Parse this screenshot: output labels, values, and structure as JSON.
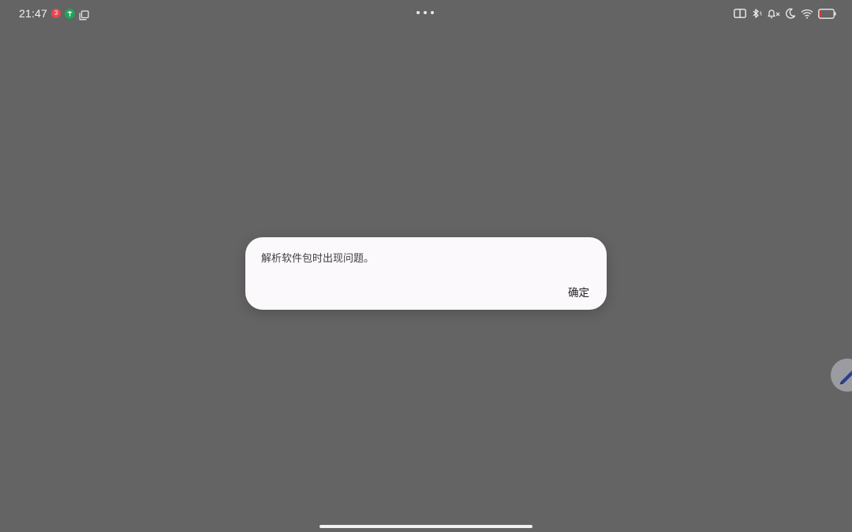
{
  "status_bar": {
    "time": "21:47",
    "notification_badge": "3",
    "icons": [
      "notification-badge-icon",
      "green-app-icon",
      "copy-icon",
      "dual-screen-icon",
      "bluetooth-icon",
      "mute-icon",
      "moon-icon",
      "wifi-icon",
      "battery-icon"
    ],
    "battery_level": 0.12,
    "battery_color": "#e3342f"
  },
  "dialog": {
    "message": "解析软件包时出现问题。",
    "ok_label": "确定"
  },
  "colors": {
    "background": "#646464",
    "dialog_background": "#fbf9fc",
    "pen_accent": "#2b3f8c"
  }
}
